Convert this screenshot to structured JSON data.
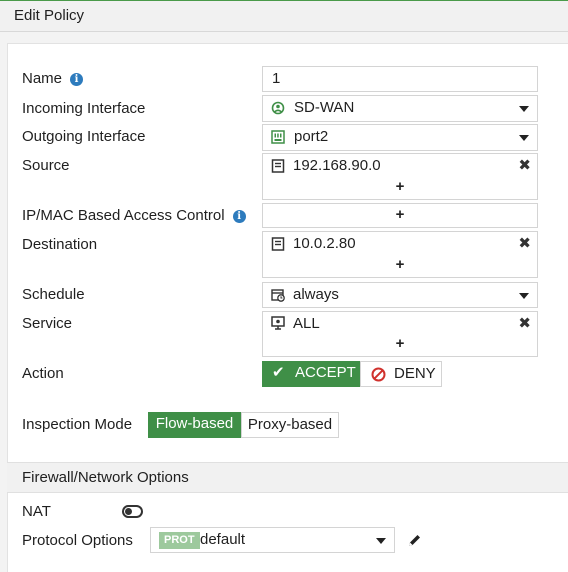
{
  "window": {
    "title": "Edit Policy"
  },
  "form": {
    "name": {
      "label": "Name",
      "value": "1"
    },
    "incoming": {
      "label": "Incoming Interface",
      "value": "SD-WAN"
    },
    "outgoing": {
      "label": "Outgoing Interface",
      "value": "port2"
    },
    "source": {
      "label": "Source",
      "value": "192.168.90.0",
      "add": "+"
    },
    "ipmac": {
      "label": "IP/MAC Based Access Control",
      "add": "+"
    },
    "destination": {
      "label": "Destination",
      "value": "10.0.2.80",
      "add": "+"
    },
    "schedule": {
      "label": "Schedule",
      "value": "always"
    },
    "service": {
      "label": "Service",
      "value": "ALL",
      "add": "+"
    },
    "action": {
      "label": "Action",
      "accept": "ACCEPT",
      "deny": "DENY",
      "selected": "ACCEPT"
    },
    "inspection": {
      "label": "Inspection Mode",
      "flow": "Flow-based",
      "proxy": "Proxy-based",
      "selected": "Flow-based"
    }
  },
  "firewall_options": {
    "title": "Firewall/Network Options",
    "nat": {
      "label": "NAT",
      "enabled": false
    },
    "protocol_options": {
      "label": "Protocol Options",
      "badge": "PROT",
      "value": "default"
    }
  },
  "colors": {
    "accent_green": "#3f8f47",
    "deny_red": "#d0312d",
    "info_blue": "#2d7bbd"
  }
}
